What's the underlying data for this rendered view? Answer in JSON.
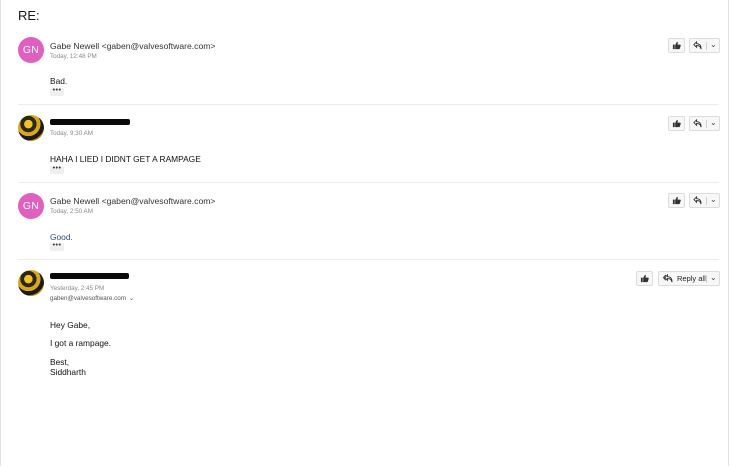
{
  "thread": {
    "subject": "RE:"
  },
  "messages": [
    {
      "sender": "Gabe Newell <gaben@valvesoftware.com>",
      "avatar_initials": "GN",
      "time": "Today, 12:48 PM",
      "body": [
        "Bad."
      ],
      "more": "•••"
    },
    {
      "sender": "",
      "avatar_initials": "",
      "time": "Today, 9:30 AM",
      "body": [
        "HAHA I LIED I DIDNT GET A RAMPAGE"
      ],
      "more": "•••"
    },
    {
      "sender": "Gabe Newell <gaben@valvesoftware.com>",
      "avatar_initials": "GN",
      "time": "Today, 2:50 AM",
      "body": [
        "Good."
      ],
      "more": "•••"
    },
    {
      "sender": "",
      "avatar_initials": "",
      "time": "Yesterday, 2:45 PM",
      "to": "gaben@valvesoftware.com",
      "body": [
        "Hey Gabe,",
        "I got a rampage.",
        "Best,",
        "Siddharth"
      ],
      "reply_all_label": "Reply all"
    }
  ],
  "icons": {
    "like": "thumbs-up-icon",
    "reply": "reply-icon",
    "reply_all": "reply-all-icon",
    "expand": "chevron-down-icon"
  },
  "colors": {
    "avatar_gabe": "#e05fbf",
    "link_text": "#2a4d7d"
  }
}
